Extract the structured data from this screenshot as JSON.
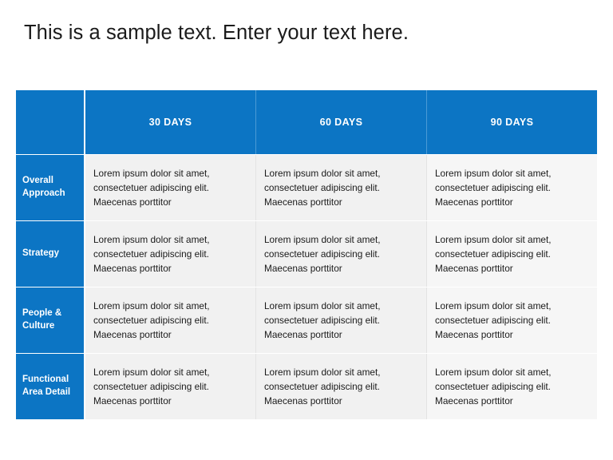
{
  "slide": {
    "title": "This is a sample text. Enter your text here.",
    "accent_color": "#0c75c4",
    "cell_background": "#f1f1f1",
    "cell_background_alt": "#f6f6f6",
    "header_text_color": "#ffffff"
  },
  "table": {
    "corner_label": "",
    "columns": [
      {
        "label": "30 DAYS"
      },
      {
        "label": "60 DAYS"
      },
      {
        "label": "90 DAYS"
      }
    ],
    "rows": [
      {
        "label": "Overall Approach",
        "cells": [
          "Lorem ipsum dolor sit amet, consectetuer adipiscing elit. Maecenas porttitor",
          "Lorem ipsum dolor sit amet, consectetuer adipiscing elit. Maecenas porttitor",
          "Lorem ipsum dolor sit amet, consectetuer adipiscing elit. Maecenas porttitor"
        ]
      },
      {
        "label": "Strategy",
        "cells": [
          "Lorem ipsum dolor sit amet, consectetuer adipiscing elit. Maecenas porttitor",
          "Lorem ipsum dolor sit amet, consectetuer adipiscing elit. Maecenas porttitor",
          "Lorem ipsum dolor sit amet, consectetuer adipiscing elit. Maecenas porttitor"
        ]
      },
      {
        "label": "People & Culture",
        "cells": [
          "Lorem ipsum dolor sit amet, consectetuer adipiscing elit. Maecenas porttitor",
          "Lorem ipsum dolor sit amet, consectetuer adipiscing elit. Maecenas porttitor",
          "Lorem ipsum dolor sit amet, consectetuer adipiscing elit. Maecenas porttitor"
        ]
      },
      {
        "label": "Functional Area Detail",
        "cells": [
          "Lorem ipsum dolor sit amet, consectetuer adipiscing elit. Maecenas porttitor",
          "Lorem ipsum dolor sit amet, consectetuer adipiscing elit. Maecenas porttitor",
          "Lorem ipsum dolor sit amet, consectetuer adipiscing elit. Maecenas porttitor"
        ]
      }
    ]
  }
}
